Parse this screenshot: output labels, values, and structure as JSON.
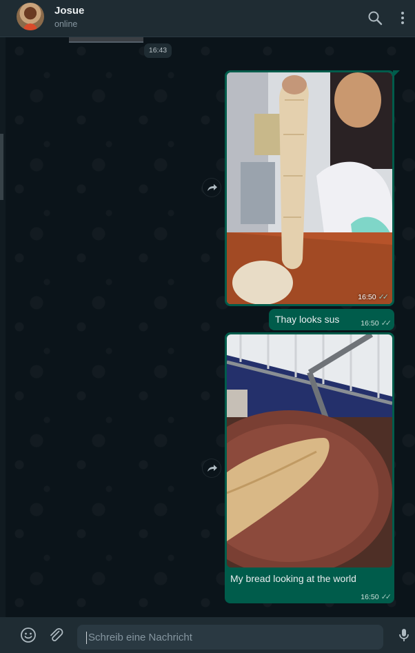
{
  "header": {
    "contact_name": "Josue",
    "contact_status": "online",
    "icons": [
      "search-icon",
      "menu-dots-icon"
    ]
  },
  "chat": {
    "date_pill": "16:43",
    "messages": [
      {
        "type": "image",
        "caption": "",
        "time": "16:50",
        "status": "read",
        "forwardable": true
      },
      {
        "type": "text",
        "text": "Thay looks sus",
        "time": "16:50",
        "status": "read"
      },
      {
        "type": "image",
        "caption": "My bread looking at the world",
        "time": "16:50",
        "status": "read",
        "forwardable": true
      }
    ]
  },
  "composer": {
    "placeholder": "Schreib eine Nachricht",
    "icons": [
      "emoji-icon",
      "attach-icon",
      "microphone-icon"
    ]
  },
  "colors": {
    "header_bg": "#1f2c33",
    "chat_bg": "#0b141a",
    "outgoing_bubble": "#005c4b",
    "secondary_text": "#8696a0"
  }
}
